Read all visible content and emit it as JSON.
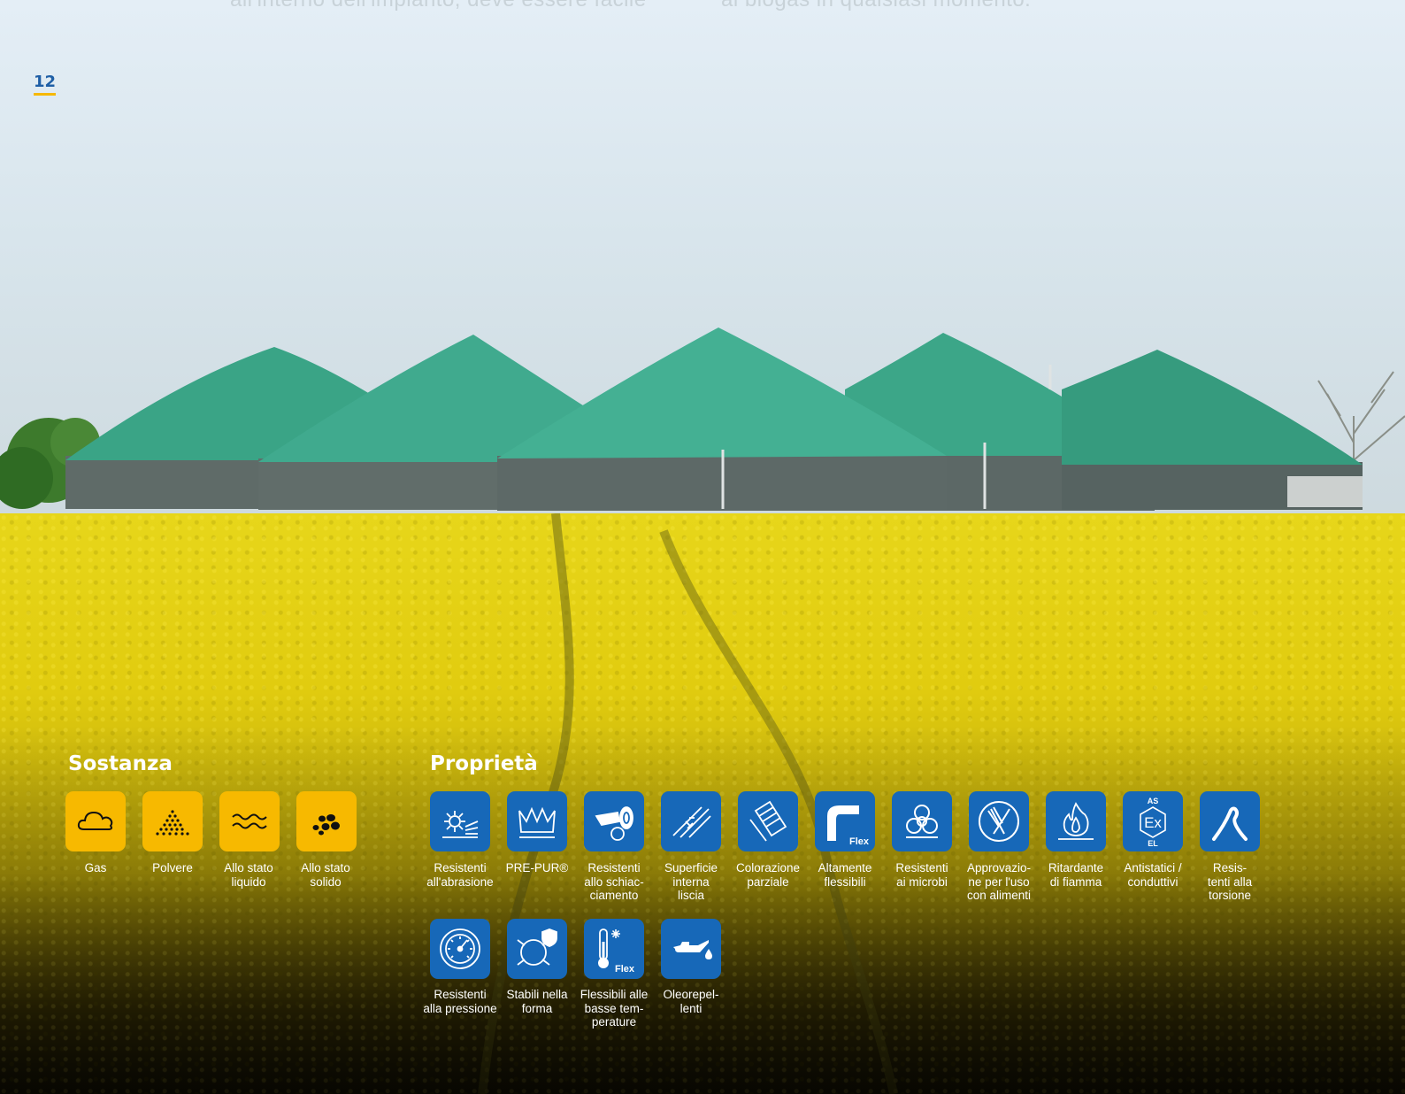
{
  "top_text": {
    "left": "all'interno dell'impianto, deve essere facile",
    "right": "al biogas in qualsiasi momento."
  },
  "page_number": "12",
  "sostanza": {
    "title": "Sostanza",
    "items": [
      {
        "label": "Gas",
        "icon": "cloud-icon"
      },
      {
        "label": "Polvere",
        "icon": "powder-icon"
      },
      {
        "label": "Allo stato\nliquido",
        "icon": "waves-icon"
      },
      {
        "label": "Allo stato\nsolido",
        "icon": "pellets-icon"
      }
    ]
  },
  "proprieta": {
    "title": "Proprietà",
    "items": [
      {
        "label": "Resistenti\nall'abrasione",
        "icon": "abrasion-icon"
      },
      {
        "label": "PRE-PUR®",
        "icon": "crown-icon"
      },
      {
        "label": "Resistenti\nallo schiac-\nciamento",
        "icon": "crush-icon"
      },
      {
        "label": "Superficie\ninterna\nliscia",
        "icon": "smooth-surface-icon"
      },
      {
        "label": "Colorazione\nparziale",
        "icon": "partial-color-icon"
      },
      {
        "label": "Altamente\nflessibili",
        "icon": "flex-hose-icon",
        "badge": "Flex"
      },
      {
        "label": "Resistenti\nai microbi",
        "icon": "biohazard-icon"
      },
      {
        "label": "Approvazio-\nne per l'uso\ncon alimenti",
        "icon": "food-approval-icon"
      },
      {
        "label": "Ritardante\ndi fiamma",
        "icon": "flame-icon"
      },
      {
        "label": "Antistatici /\nconduttivi",
        "icon": "ex-antistatic-icon",
        "top": "AS",
        "mid": "Ex",
        "bottom": "EL"
      },
      {
        "label": "Resis-\ntenti alla\ntorsione",
        "icon": "torsion-icon"
      },
      {
        "label": "Resistenti\nalla pressione",
        "icon": "pressure-gauge-icon"
      },
      {
        "label": "Stabili nella\nforma",
        "icon": "shape-stable-icon"
      },
      {
        "label": "Flessibili alle\nbasse tem-\nperature",
        "icon": "cold-thermometer-icon",
        "badge": "Flex"
      },
      {
        "label": "Oleorepel-\nlenti",
        "icon": "oil-can-icon"
      }
    ]
  },
  "colors": {
    "accent_yellow": "#f7b900",
    "accent_blue": "#1768b8",
    "page_number_blue": "#1f5fa6"
  }
}
